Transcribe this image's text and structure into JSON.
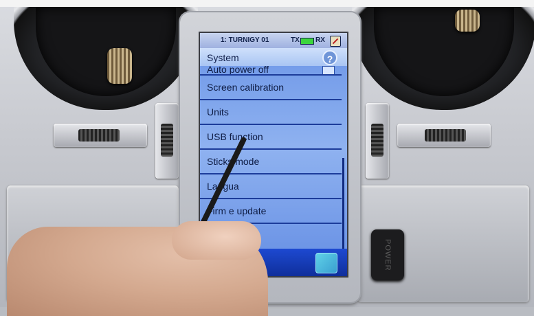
{
  "header": {
    "model_name": "1: TURNIGY 01",
    "tx_label": "TX",
    "rx_label": "RX"
  },
  "page": {
    "title": "System",
    "help_label": "?"
  },
  "menu": {
    "items": [
      {
        "label": "Auto power off",
        "checked": true
      },
      {
        "label": "Screen calibration"
      },
      {
        "label": "Units"
      },
      {
        "label": "USB function"
      },
      {
        "label": "Sticks mode"
      },
      {
        "label": "Langua"
      },
      {
        "label": "Firm     e update"
      }
    ]
  },
  "hardware": {
    "power_label": "POWER"
  },
  "colors": {
    "screen_bg": "#1a3a9e",
    "menu_bg": "#8fb2f0",
    "text": "#0e1c44",
    "battery": "#3dd63d"
  },
  "icons": {
    "help": "question-mark-icon",
    "rx_status": "no-signal-icon",
    "back": "back-icon"
  }
}
